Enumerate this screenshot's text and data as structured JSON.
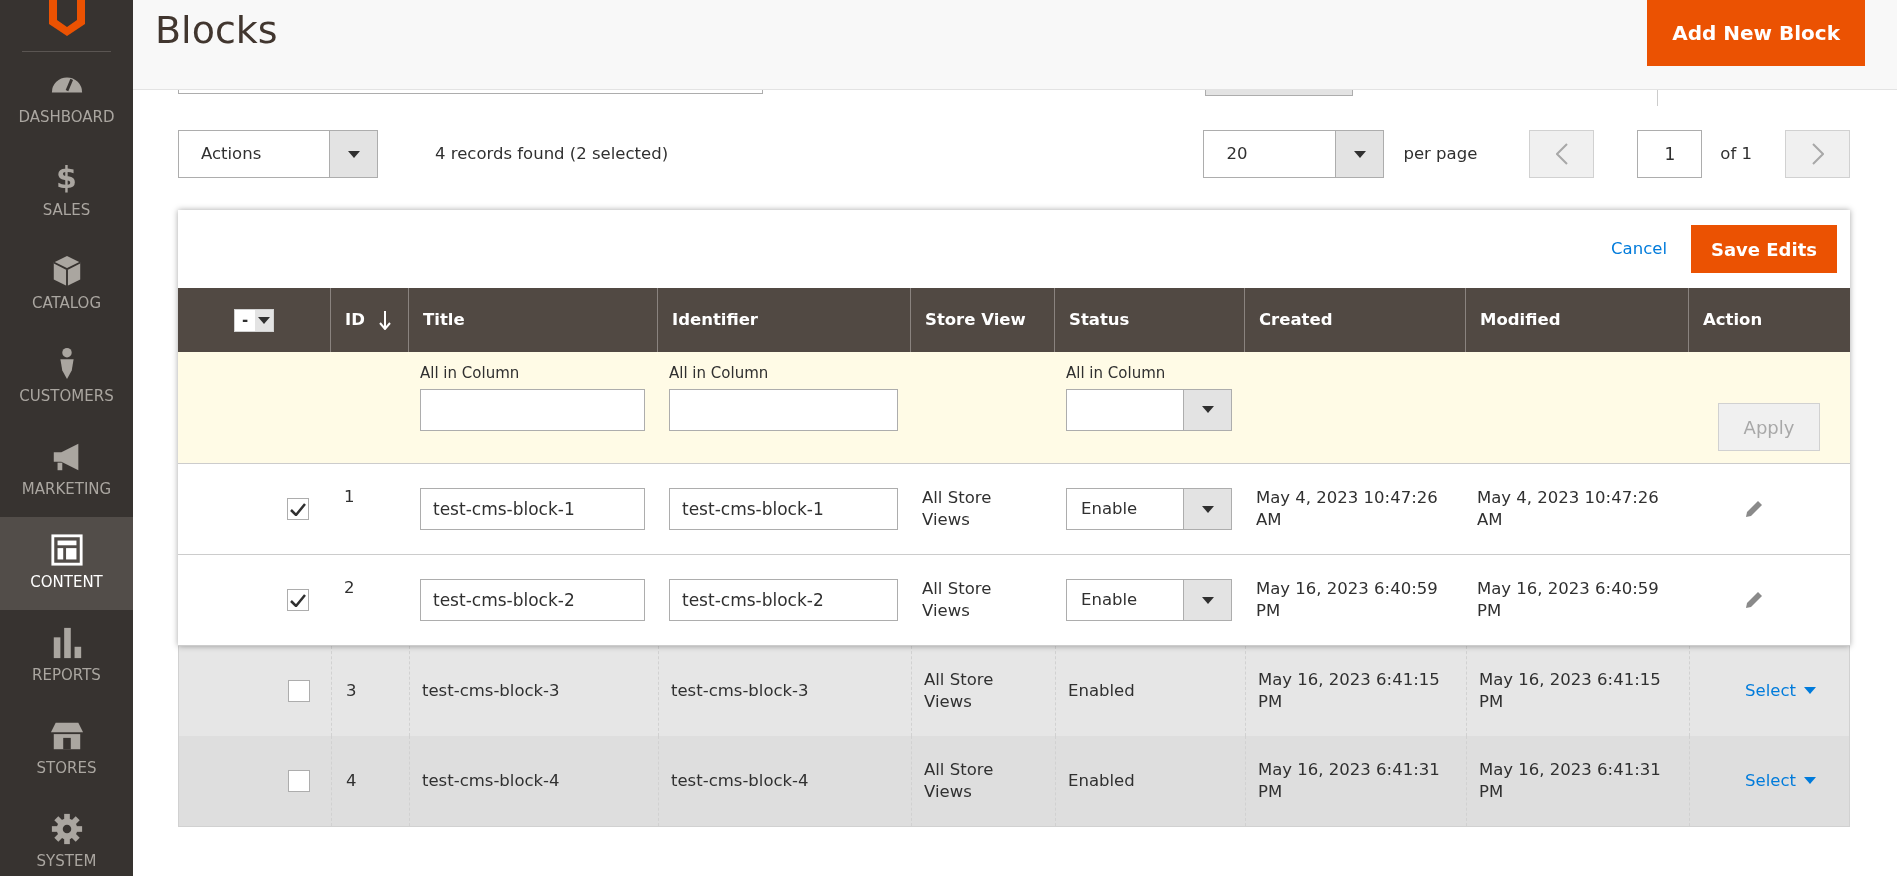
{
  "sidebar": {
    "items": [
      {
        "label": "DASHBOARD",
        "selected": false
      },
      {
        "label": "SALES",
        "glyph": "$",
        "selected": false
      },
      {
        "label": "CATALOG",
        "selected": false
      },
      {
        "label": "CUSTOMERS",
        "selected": false
      },
      {
        "label": "MARKETING",
        "selected": false
      },
      {
        "label": "CONTENT",
        "selected": true
      },
      {
        "label": "REPORTS",
        "selected": false
      },
      {
        "label": "STORES",
        "selected": false
      },
      {
        "label": "SYSTEM",
        "selected": false
      }
    ]
  },
  "page_title": "Blocks",
  "add_button": "Add New Block",
  "toolbar": {
    "actions": "Actions",
    "records": "4 records found (2 selected)",
    "per_page_value": "20",
    "per_page_label": "per page",
    "page_value": "1",
    "page_of": "of 1"
  },
  "inline_edit": {
    "cancel": "Cancel",
    "save": "Save Edits"
  },
  "table": {
    "mass_select": "-",
    "columns": [
      {
        "label": "ID",
        "sorted": true
      },
      {
        "label": "Title"
      },
      {
        "label": "Identifier"
      },
      {
        "label": "Store View"
      },
      {
        "label": "Status"
      },
      {
        "label": "Created"
      },
      {
        "label": "Modified"
      },
      {
        "label": "Action"
      }
    ],
    "bulk": {
      "title_label": "All in Column",
      "identifier_label": "All in Column",
      "status_label": "All in Column",
      "apply": "Apply",
      "apply_disabled": true
    },
    "rows": [
      {
        "checked": true,
        "editing": true,
        "id": "1",
        "title": "test-cms-block-1",
        "identifier": "test-cms-block-1",
        "store_view": "All Store Views",
        "status": "Enable",
        "created": "May 4, 2023 10:47:26 AM",
        "modified": "May 4, 2023 10:47:26 AM"
      },
      {
        "checked": true,
        "editing": true,
        "id": "2",
        "title": "test-cms-block-2",
        "identifier": "test-cms-block-2",
        "store_view": "All Store Views",
        "status": "Enable",
        "created": "May 16, 2023 6:40:59 PM",
        "modified": "May 16, 2023 6:40:59 PM"
      },
      {
        "checked": false,
        "editing": false,
        "id": "3",
        "title": "test-cms-block-3",
        "identifier": "test-cms-block-3",
        "store_view": "All Store Views",
        "status": "Enabled",
        "created": "May 16, 2023 6:41:15 PM",
        "modified": "May 16, 2023 6:41:15 PM",
        "action": "Select"
      },
      {
        "checked": false,
        "editing": false,
        "id": "4",
        "title": "test-cms-block-4",
        "identifier": "test-cms-block-4",
        "store_view": "All Store Views",
        "status": "Enabled",
        "created": "May 16, 2023 6:41:31 PM",
        "modified": "May 16, 2023 6:41:31 PM",
        "action": "Select"
      }
    ]
  }
}
